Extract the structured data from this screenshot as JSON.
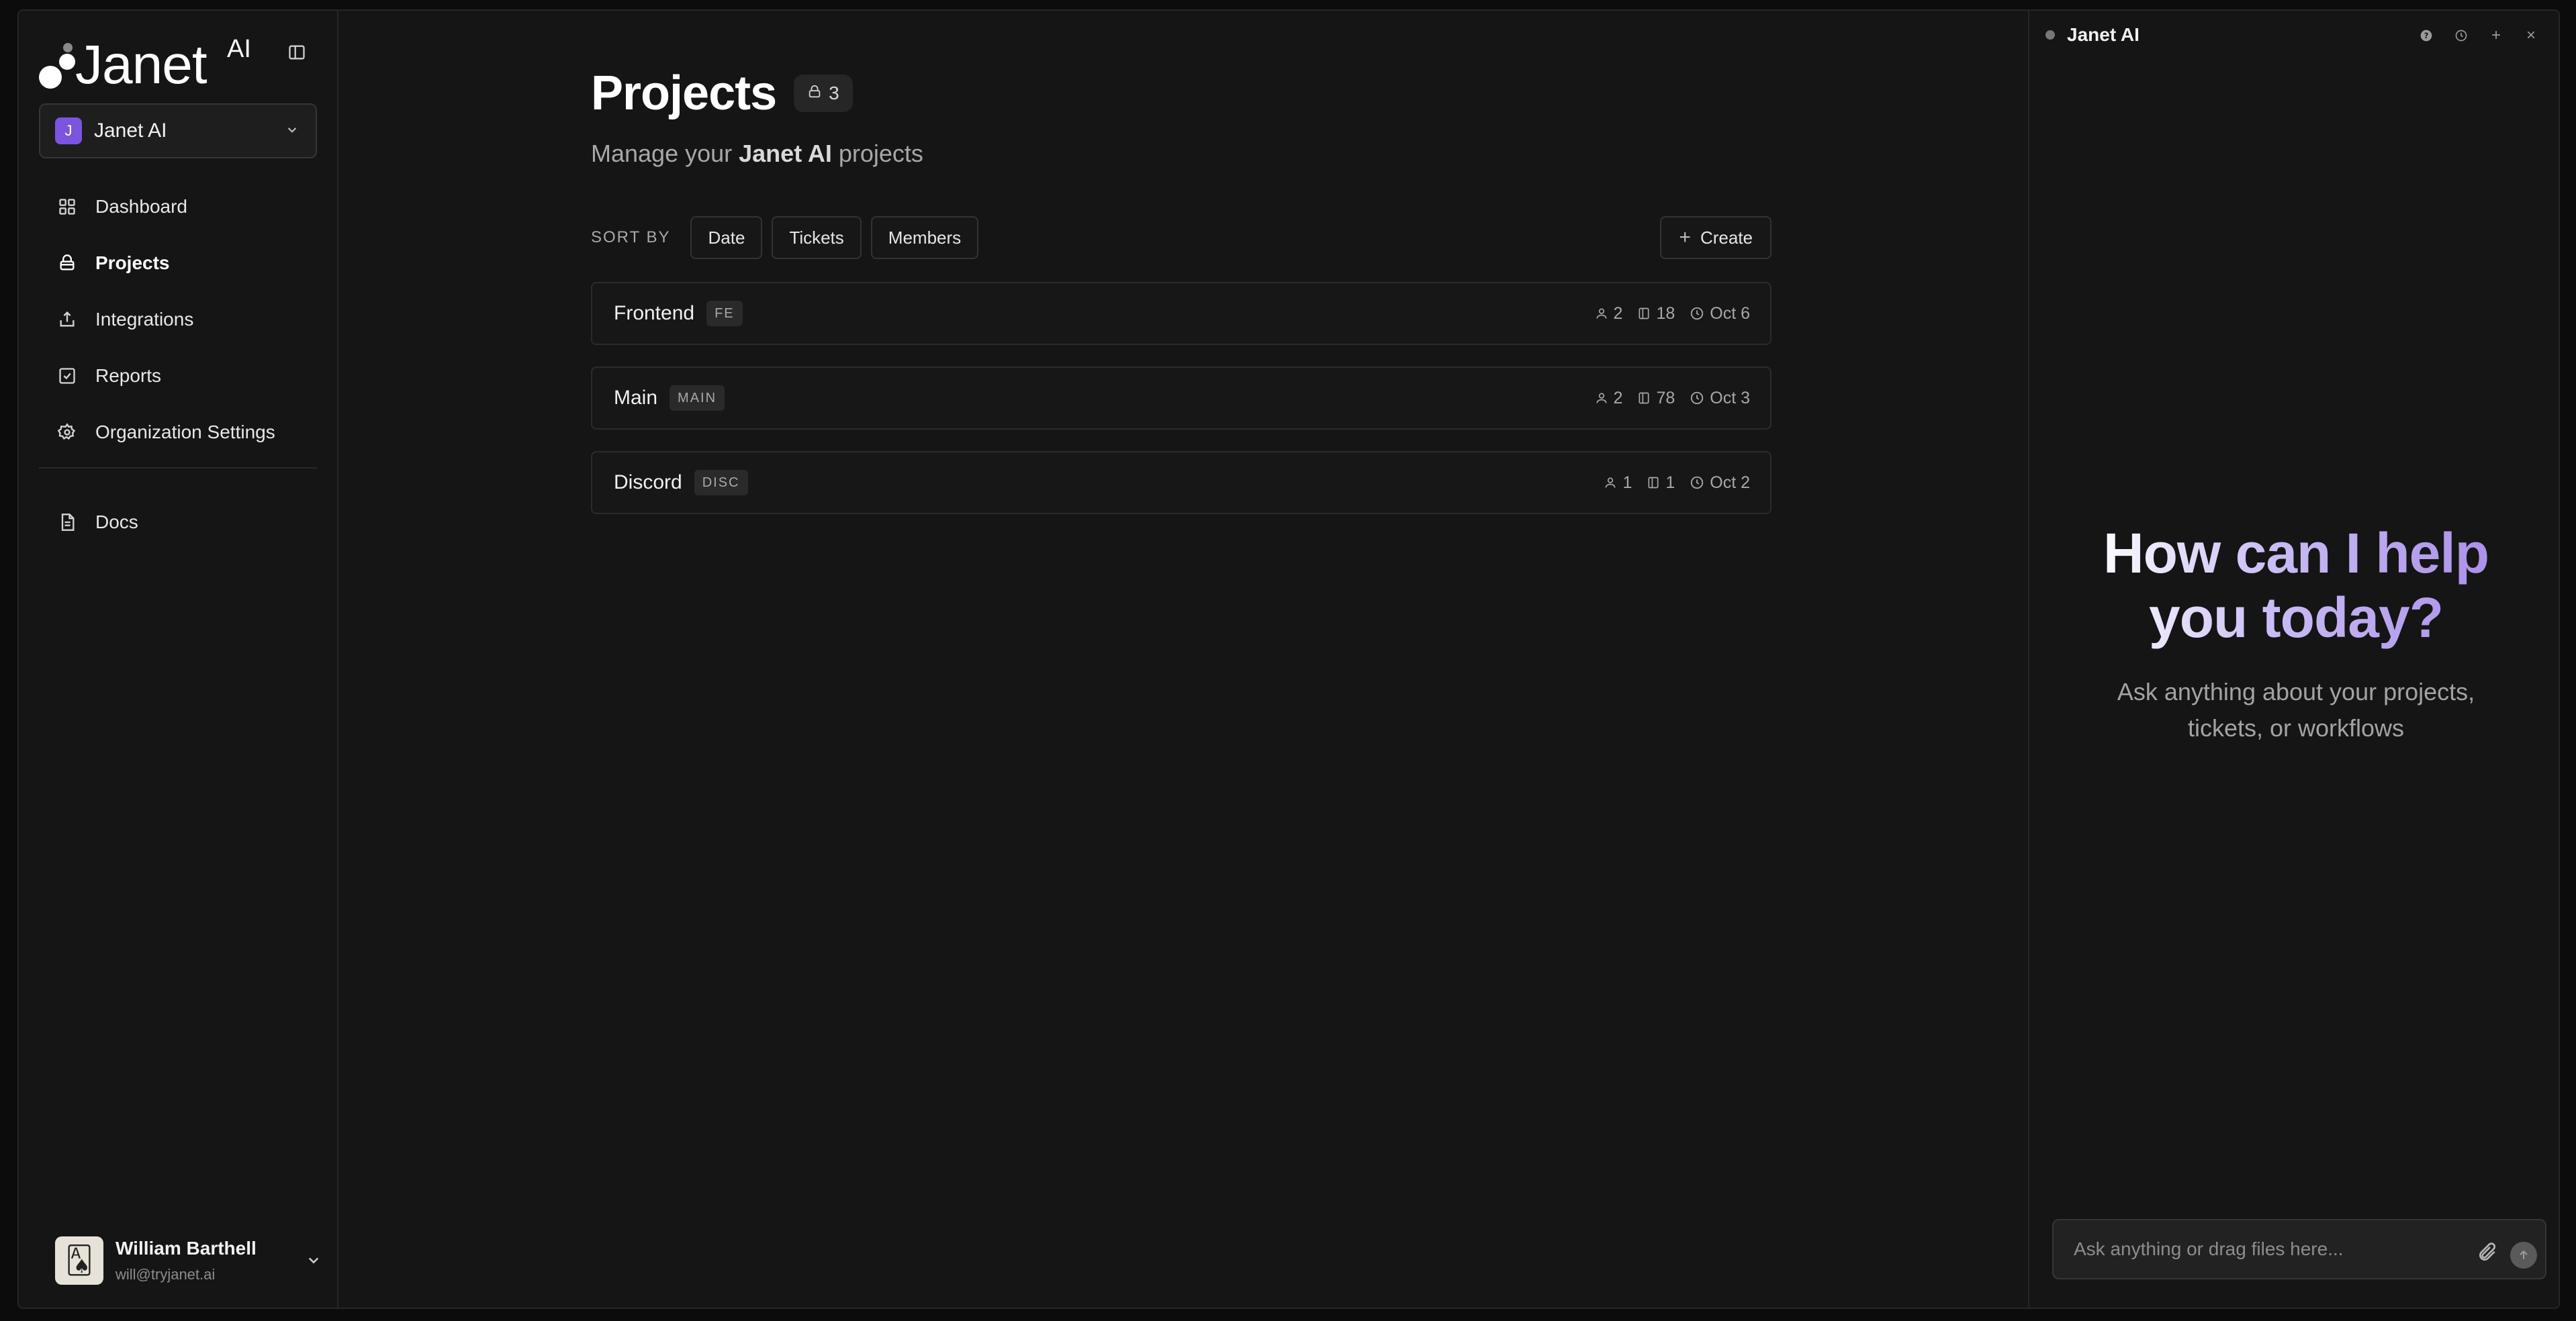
{
  "sidebar": {
    "logo_text": "Janet",
    "logo_suffix": "AI",
    "org": {
      "initial": "J",
      "name": "Janet AI"
    },
    "nav": [
      {
        "label": "Dashboard",
        "icon": "grid-icon"
      },
      {
        "label": "Projects",
        "icon": "lock-icon",
        "active": true
      },
      {
        "label": "Integrations",
        "icon": "share-icon"
      },
      {
        "label": "Reports",
        "icon": "checkbox-icon"
      },
      {
        "label": "Organization Settings",
        "icon": "gear-icon"
      }
    ],
    "secondary": [
      {
        "label": "Docs",
        "icon": "document-icon"
      }
    ],
    "user": {
      "name": "William Barthell",
      "email": "will@tryjanet.ai"
    }
  },
  "main": {
    "title": "Projects",
    "count": "3",
    "subtitle_prefix": "Manage your ",
    "subtitle_org": "Janet AI",
    "subtitle_suffix": " projects",
    "sort_label": "SORT BY",
    "sort_options": [
      "Date",
      "Tickets",
      "Members"
    ],
    "create_label": "Create",
    "projects": [
      {
        "name": "Frontend",
        "key": "FE",
        "members": "2",
        "tickets": "18",
        "date": "Oct 6"
      },
      {
        "name": "Main",
        "key": "MAIN",
        "members": "2",
        "tickets": "78",
        "date": "Oct 3"
      },
      {
        "name": "Discord",
        "key": "DISC",
        "members": "1",
        "tickets": "1",
        "date": "Oct 2"
      }
    ]
  },
  "assistant": {
    "title": "Janet AI",
    "actions": [
      "help-icon",
      "history-icon",
      "plus-icon",
      "close-icon"
    ],
    "hero_title": "How can I help you today?",
    "hero_subtitle": "Ask anything about your projects, tickets, or workflows",
    "input_placeholder": "Ask anything or drag files here..."
  },
  "colors": {
    "background": "#151515",
    "accent": "#7b55e0",
    "hero_gradient_end": "#a98ee8"
  }
}
